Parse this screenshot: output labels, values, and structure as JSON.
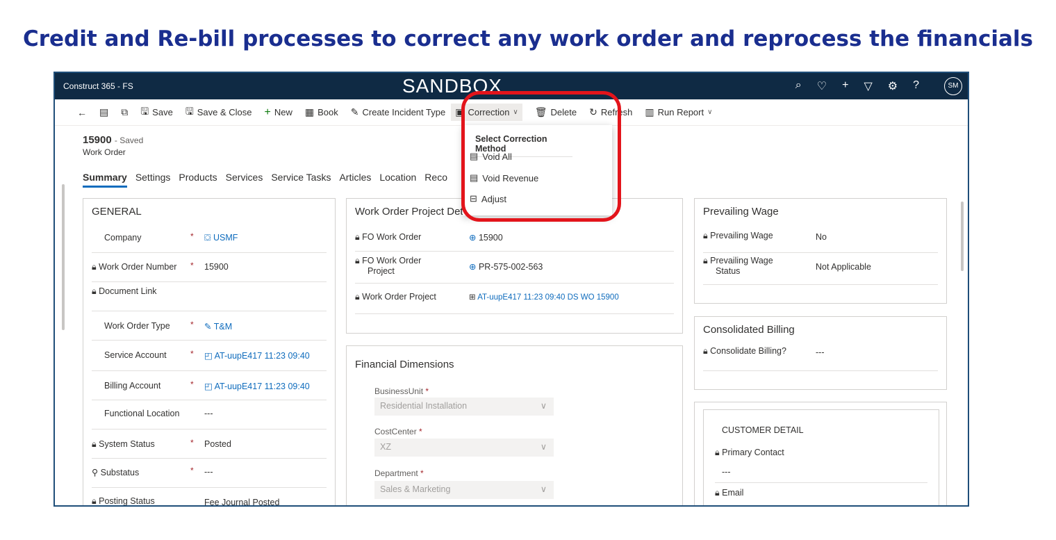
{
  "slide_title": "Credit and Re-bill processes to correct any work order and reprocess the financials",
  "topbar": {
    "app_name": "Construct 365 - FS",
    "environment": "SANDBOX",
    "avatar": "SM",
    "icons": [
      "search-icon",
      "lightbulb-icon",
      "plus-icon",
      "filter-icon",
      "gear-icon",
      "help-icon"
    ]
  },
  "commands": {
    "save": "Save",
    "save_close": "Save & Close",
    "new": "New",
    "book": "Book",
    "create_incident_type": "Create Incident Type",
    "correction": "Correction",
    "delete": "Delete",
    "refresh": "Refresh",
    "run_report": "Run Report"
  },
  "correction_menu": {
    "header": "Select Correction Method",
    "items": [
      "Void All",
      "Void Revenue",
      "Adjust"
    ]
  },
  "record": {
    "number": "15900",
    "status": "- Saved",
    "entity": "Work Order"
  },
  "tabs": [
    "Summary",
    "Settings",
    "Products",
    "Services",
    "Service Tasks",
    "Articles",
    "Location",
    "Reco"
  ],
  "general": {
    "title": "GENERAL",
    "fields": [
      {
        "label": "Company",
        "value": "USMF"
      },
      {
        "label": "Work Order Number",
        "value": "15900"
      },
      {
        "label": "Document Link",
        "value": ""
      },
      {
        "label": "Work Order Type",
        "value": "T&M"
      },
      {
        "label": "Service Account",
        "value": "AT-uupE417 11:23 09:40"
      },
      {
        "label": "Billing Account",
        "value": "AT-uupE417 11:23 09:40"
      },
      {
        "label": "Functional Location",
        "value": "---"
      },
      {
        "label": "System Status",
        "value": "Posted"
      },
      {
        "label": "Substatus",
        "value": "---"
      },
      {
        "label": "Posting Status",
        "value": "Fee Journal Posted"
      }
    ]
  },
  "project_details": {
    "title": "Work Order Project Det",
    "fields": [
      {
        "label": "FO Work Order",
        "value": "15900"
      },
      {
        "label": "FO Work Order",
        "label2": "Project",
        "value": "PR-575-002-563"
      },
      {
        "label": "Work Order Project",
        "value": "AT-uupE417 11:23 09:40 DS WO 15900"
      }
    ]
  },
  "financial_dimensions": {
    "title": "Financial Dimensions",
    "fields": [
      {
        "label": "BusinessUnit",
        "value": "Residential Installation"
      },
      {
        "label": "CostCenter",
        "value": "XZ"
      },
      {
        "label": "Department",
        "value": "Sales & Marketing"
      }
    ]
  },
  "prevailing_wage": {
    "title": "Prevailing Wage",
    "fields": [
      {
        "label": "Prevailing Wage",
        "value": "No"
      },
      {
        "label": "Prevailing Wage",
        "label2": "Status",
        "value": "Not Applicable"
      }
    ]
  },
  "consolidated_billing": {
    "title": "Consolidated Billing",
    "field": {
      "label": "Consolidate Billing?",
      "value": "---"
    }
  },
  "customer_detail": {
    "title": "CUSTOMER DETAIL",
    "primary_contact_label": "Primary Contact",
    "primary_contact_value": "---",
    "email_label": "Email"
  },
  "colors": {
    "title_blue": "#1a2e8f",
    "topbar": "#0f2a44",
    "link": "#0f6cbd",
    "required": "#a4262c",
    "highlight": "#e3141b"
  }
}
